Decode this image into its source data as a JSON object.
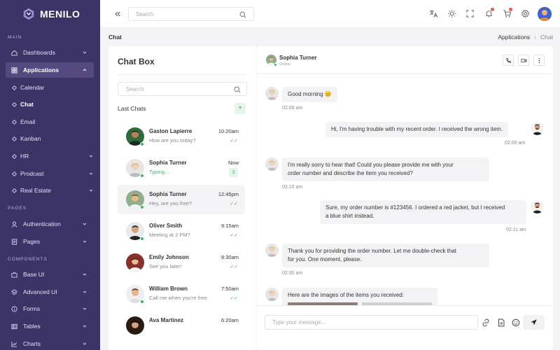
{
  "brand": {
    "name": "MENILO"
  },
  "sidebar": {
    "sections": {
      "main": "MAIN",
      "pages": "PAGES",
      "components": "COMPONENTS"
    },
    "items": {
      "dashboards": "Dashboards",
      "applications": "Applications",
      "calendar": "Calendar",
      "chat": "Chat",
      "email": "Email",
      "kanban": "Kanban",
      "hr": "HR",
      "prodcast": "Prodcast",
      "real_estate": "Real Estate",
      "authentication": "Authentication",
      "pages": "Pages",
      "base_ui": "Base UI",
      "advanced_ui": "Advanced UI",
      "forms": "Forms",
      "tables": "Tables",
      "charts": "Charts"
    }
  },
  "header": {
    "search_placeholder": "Search"
  },
  "page": {
    "title": "Chat",
    "breadcrumb": {
      "parent": "Applications",
      "separator": "›",
      "current": "Chat"
    }
  },
  "chat_list": {
    "title": "Chat Box",
    "search_placeholder": "Search",
    "last_chats_label": "Last Chats",
    "add_label": "+",
    "contacts": [
      {
        "name": "Gaston Lapierre",
        "message": "How are you today?",
        "time": "10:20am",
        "status": "✓✓"
      },
      {
        "name": "Sophia Turner",
        "message": "Typing...",
        "time": "Now",
        "badge": "3"
      },
      {
        "name": "Sophia Turner",
        "message": "Hey, are you free?",
        "time": "12:45pm",
        "status": "✓✓"
      },
      {
        "name": "Oliver Smith",
        "message": "Meeting at 2 PM?",
        "time": "9:15am",
        "status": "✓✓"
      },
      {
        "name": "Emily Johnson",
        "message": "See you later!",
        "time": "8:30am",
        "status": "✓✓"
      },
      {
        "name": "William Brown",
        "message": "Call me when you're free.",
        "time": "7:50am",
        "status": "✓✓"
      },
      {
        "name": "Ava Martinez",
        "message": "",
        "time": "6:20am"
      }
    ]
  },
  "conversation": {
    "contact_name": "Sophia Turner",
    "contact_status": "Online",
    "messages": [
      {
        "text": "Good morning 😊",
        "time": "02:08 am"
      },
      {
        "text": "Hi, I'm having trouble with my recent order. I received the wrong item.",
        "time": "02:09 am"
      },
      {
        "text_line1": "I'm really sorry to hear that! Could you please provide me with your",
        "text_line2": "order number and describe the item you received?",
        "time": "02:10 am"
      },
      {
        "text_line1": "Sure, my order number is #123456. I ordered a red jacket, but I received",
        "text_line2": "a blue shirt instead.",
        "time": "02:11 am"
      },
      {
        "text_line1": "Thank you for providing the order number. Let me double-check that",
        "text_line2": "for you. One moment, please.",
        "time": "02:30 am"
      },
      {
        "text": "Here are the images of the items you received:"
      }
    ],
    "input_placeholder": "Type your message..."
  },
  "colors": {
    "sidebar": "#3c3366",
    "accent_green": "#36b865",
    "notification": "#f05252"
  }
}
